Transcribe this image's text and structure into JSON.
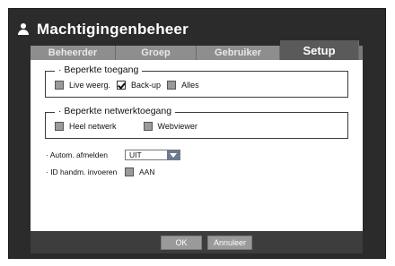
{
  "window": {
    "title": "Machtigingenbeheer",
    "title_icon": "user-icon"
  },
  "tabs": [
    {
      "label": "Beheerder",
      "active": false
    },
    {
      "label": "Groep",
      "active": false
    },
    {
      "label": "Gebruiker",
      "active": false
    },
    {
      "label": "Setup",
      "active": true
    }
  ],
  "access": {
    "legend": "· Beperkte toegang",
    "options": [
      {
        "label": "Live weerg.",
        "checked": false
      },
      {
        "label": "Back-up",
        "checked": true
      },
      {
        "label": "Alles",
        "checked": false
      }
    ]
  },
  "network": {
    "legend": "· Beperkte netwerktoegang",
    "options": [
      {
        "label": "Heel netwerk",
        "checked": false
      },
      {
        "label": "Webviewer",
        "checked": false
      }
    ]
  },
  "auto_logout": {
    "label": "· Autom. afmelden",
    "value": "UIT"
  },
  "manual_id": {
    "label": "· ID handm. invoeren",
    "checkbox_label": "AAN",
    "checked": false
  },
  "buttons": {
    "ok": "OK",
    "cancel": "Annuleer"
  },
  "colors": {
    "window_bg": "#2b2b2b",
    "tab_bg": "#8e8e8e",
    "tab_active_bg": "#5a5a5a",
    "checkbox_unchecked": "#9a9a9a",
    "button_bg": "#9a9a9a"
  }
}
